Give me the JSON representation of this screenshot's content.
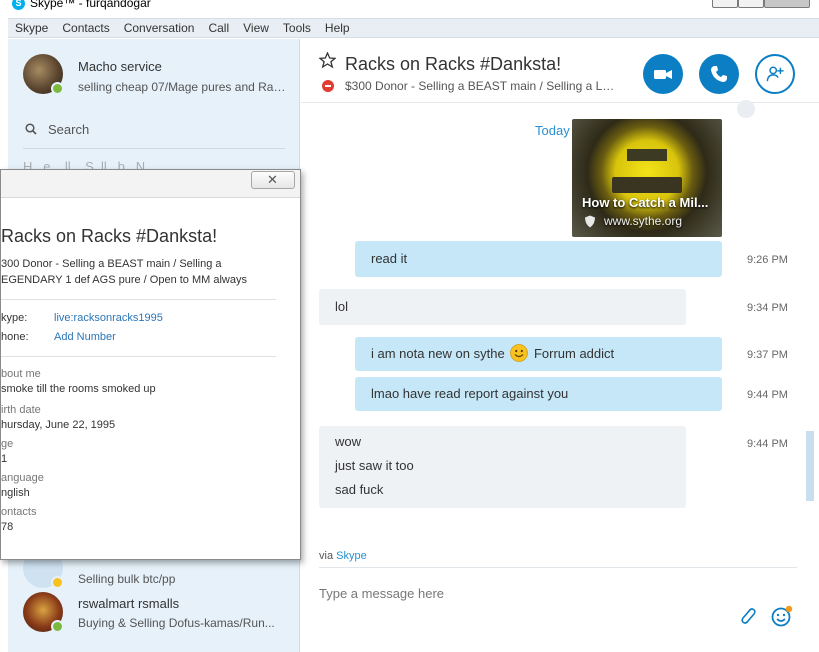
{
  "window": {
    "title": "Skype™ - furqandogar"
  },
  "menu": [
    "Skype",
    "Contacts",
    "Conversation",
    "Call",
    "View",
    "Tools",
    "Help"
  ],
  "profile": {
    "name": "Macho service",
    "mood": "selling cheap 07/Mage pures and Ran..."
  },
  "search": {
    "label": "Search"
  },
  "recent_ghost": "H...e ...ll... S..ll.. b.. N...",
  "contacts": [
    {
      "name": "",
      "mood": "Selling bulk btc/pp",
      "status": "away"
    },
    {
      "name": "rswalmart rsmalls",
      "mood": "Buying & Selling Dofus-kamas/Run...",
      "status": "online"
    }
  ],
  "chat": {
    "title": "Racks on Racks #Danksta!",
    "mood": "$300 Donor - Selling a BEAST main / Selling a LE...",
    "day": "Today",
    "link_preview": {
      "title": "How to Catch a Mil...",
      "domain": "www.sythe.org"
    },
    "messages": [
      {
        "dir": "out",
        "lines": [
          "read it"
        ],
        "time": "9:26 PM"
      },
      {
        "dir": "in",
        "lines": [
          "lol"
        ],
        "time": "9:34 PM"
      },
      {
        "dir": "out",
        "lines": [
          "i am nota new on sythe",
          "Forrum addict"
        ],
        "time": "9:37 PM"
      },
      {
        "dir": "out",
        "lines": [
          "lmao have read report against you"
        ],
        "time": "9:44 PM"
      },
      {
        "dir": "in",
        "lines": [
          "wow",
          "just saw it too",
          "sad fuck"
        ],
        "time": "9:44 PM"
      }
    ],
    "via_prefix": "via",
    "via_link": "Skype",
    "compose_placeholder": "Type a message here"
  },
  "popup": {
    "name": "Racks on Racks #Danksta!",
    "mood_line1": "300 Donor - Selling a BEAST main / Selling a",
    "mood_line2": "EGENDARY 1 def AGS pure /  Open to MM always",
    "skype_label": "kype:",
    "skype_value": "live:racksonracks1995",
    "phone_label": "hone:",
    "phone_value": "Add Number",
    "about_label": "bout me",
    "about_value": "smoke till the rooms smoked up",
    "birth_label": "irth date",
    "birth_value": "hursday, June 22, 1995",
    "age_label": "ge",
    "age_value": "1",
    "language_label": "anguage",
    "language_value": "nglish",
    "contacts_label": "ontacts",
    "contacts_value": "78"
  },
  "colors": {
    "accent": "#0b7ec4",
    "link": "#2a8fd0",
    "out_bubble": "#c6e7f8",
    "in_bubble": "#eff2f5",
    "sidebar": "#e6f1fa"
  }
}
